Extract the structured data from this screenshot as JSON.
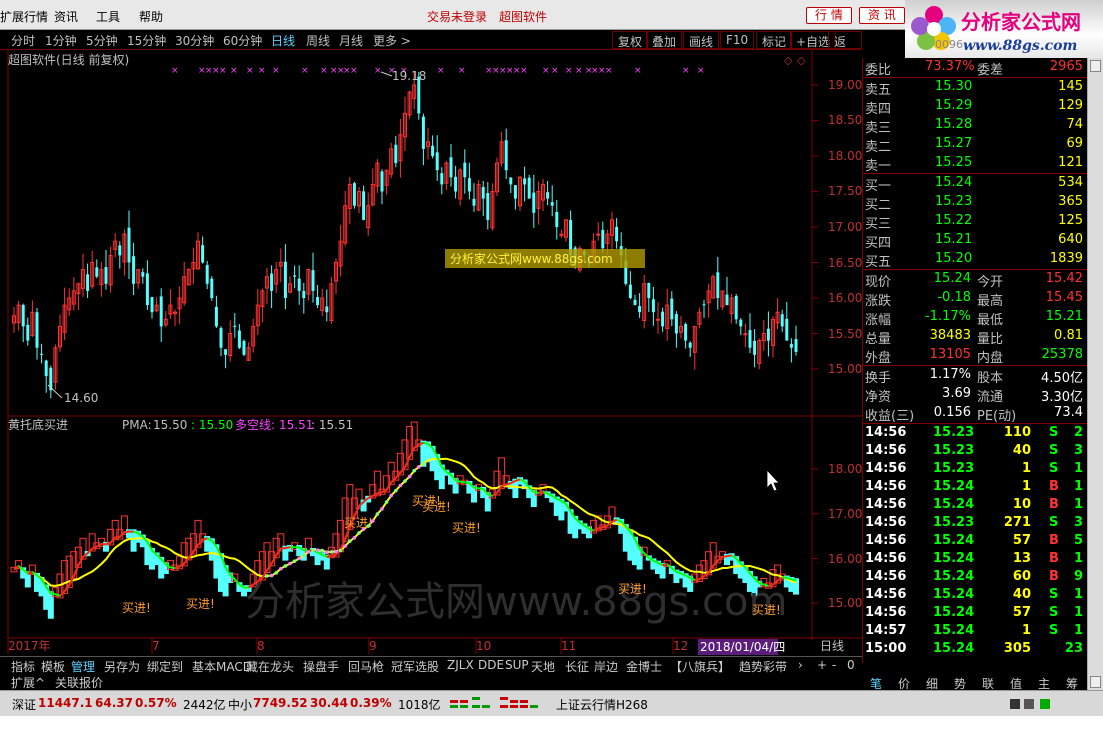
{
  "menu": {
    "items": [
      "扩展行情",
      "资讯",
      "工具",
      "帮助"
    ],
    "login": "交易未登录",
    "software": "超图软件",
    "btn_quote": "行 情",
    "btn_news": "资 讯"
  },
  "logo": {
    "title": "分析家公式网",
    "url": "www.88gs.com",
    "ghost": "0096"
  },
  "periods": [
    "分时",
    "1分钟",
    "5分钟",
    "15分钟",
    "30分钟",
    "60分钟",
    "日线",
    "周线",
    "月线",
    "更多 >"
  ],
  "active_period": "日线",
  "toolbar": [
    "复权",
    "叠加",
    "画线",
    "F10",
    "标记",
    "+自选",
    "返回"
  ],
  "main_chart": {
    "title": "超图软件(日线 前复权)",
    "high_label": "19.18",
    "low_label": "14.60",
    "watermark": "分析家公式网www.88gs.com",
    "y_ticks": [
      "19.00",
      "18.50",
      "18.00",
      "17.50",
      "17.00",
      "16.50",
      "16.00",
      "15.50",
      "15.00"
    ]
  },
  "indicator": {
    "name": "黄托底买进",
    "pma_label": "PMA:",
    "pma_value": "15.50",
    "v2": ": 15.50",
    "dk_label": "多空线:",
    "dk_value": "15.51",
    "v4": ": 15.51",
    "buy_label": "买进!",
    "watermark": "分析家公式网www.88gs.com",
    "y_ticks": [
      "18.00",
      "17.00",
      "16.00",
      "15.00"
    ]
  },
  "xaxis": {
    "labels": [
      "2017年",
      "7",
      "8",
      "9",
      "10",
      "11",
      "12"
    ],
    "date_badge": "2018/01/04/四",
    "period": "日线"
  },
  "quote": {
    "weibi_label": "委比",
    "weibi": "73.37%",
    "weicha_label": "委差",
    "weicha": "2965",
    "sells": [
      [
        "卖五",
        "15.30",
        "145"
      ],
      [
        "卖四",
        "15.29",
        "129"
      ],
      [
        "卖三",
        "15.28",
        "74"
      ],
      [
        "卖二",
        "15.27",
        "69"
      ],
      [
        "卖一",
        "15.25",
        "121"
      ]
    ],
    "buys": [
      [
        "买一",
        "15.24",
        "534"
      ],
      [
        "买二",
        "15.23",
        "365"
      ],
      [
        "买三",
        "15.22",
        "125"
      ],
      [
        "买四",
        "15.21",
        "640"
      ],
      [
        "买五",
        "15.20",
        "1839"
      ]
    ],
    "stats": [
      [
        "现价",
        "15.24",
        "今开",
        "15.42"
      ],
      [
        "涨跌",
        "-0.18",
        "最高",
        "15.45"
      ],
      [
        "涨幅",
        "-1.17%",
        "最低",
        "15.21"
      ],
      [
        "总量",
        "38483",
        "量比",
        "0.81"
      ],
      [
        "外盘",
        "13105",
        "内盘",
        "25378"
      ]
    ],
    "fund": [
      [
        "换手",
        "1.17%",
        "股本",
        "4.50亿"
      ],
      [
        "净资",
        "3.69",
        "流通",
        "3.30亿"
      ],
      [
        "收益(三)",
        "0.156",
        "PE(动)",
        "73.4"
      ]
    ],
    "ticks": [
      [
        "14:56",
        "15.23",
        "110",
        "S",
        "2"
      ],
      [
        "14:56",
        "15.23",
        "40",
        "S",
        "3"
      ],
      [
        "14:56",
        "15.23",
        "1",
        "S",
        "1"
      ],
      [
        "14:56",
        "15.24",
        "1",
        "B",
        "1"
      ],
      [
        "14:56",
        "15.24",
        "10",
        "B",
        "1"
      ],
      [
        "14:56",
        "15.23",
        "271",
        "S",
        "3"
      ],
      [
        "14:56",
        "15.24",
        "57",
        "B",
        "5"
      ],
      [
        "14:56",
        "15.24",
        "13",
        "B",
        "1"
      ],
      [
        "14:56",
        "15.24",
        "60",
        "B",
        "9"
      ],
      [
        "14:56",
        "15.24",
        "40",
        "S",
        "1"
      ],
      [
        "14:56",
        "15.24",
        "57",
        "S",
        "1"
      ],
      [
        "14:57",
        "15.24",
        "1",
        "S",
        "1"
      ],
      [
        "15:00",
        "15.24",
        "305",
        "",
        "23"
      ]
    ]
  },
  "bottom_tabs": [
    "指标",
    "模板",
    "管理",
    "另存为",
    "绑定到",
    "基本MACD",
    "藏在龙头",
    "操盘手",
    "回马枪",
    "冠军选股",
    "ZJLX",
    "DDE",
    "SUP",
    "天地",
    "长征",
    "岸边",
    "金博士",
    "【八旗兵】",
    "趋势彩带"
  ],
  "bottom_right": [
    "+",
    "-",
    "0"
  ],
  "expand": [
    "扩展^",
    "关联报价"
  ],
  "right_tabs": [
    "笔",
    "价",
    "细",
    "势",
    "联",
    "值",
    "主",
    "筹"
  ],
  "status": {
    "index_name": "深证",
    "index_val": "11447.1",
    "index_chg": "64.37",
    "index_pct": "0.57%",
    "index_amt": "2442亿",
    "mid_name": "中小",
    "mid_val": "7749.52",
    "mid_chg": "30.44",
    "mid_pct": "0.39%",
    "mid_amt": "1018亿",
    "cloud": "上证云行情H268"
  },
  "colors": {
    "up": "#ff3232",
    "down": "#54ffff",
    "grid": "#800000",
    "yellow": "#ffff00",
    "green": "#00ff00",
    "magenta": "#ff40ff"
  }
}
